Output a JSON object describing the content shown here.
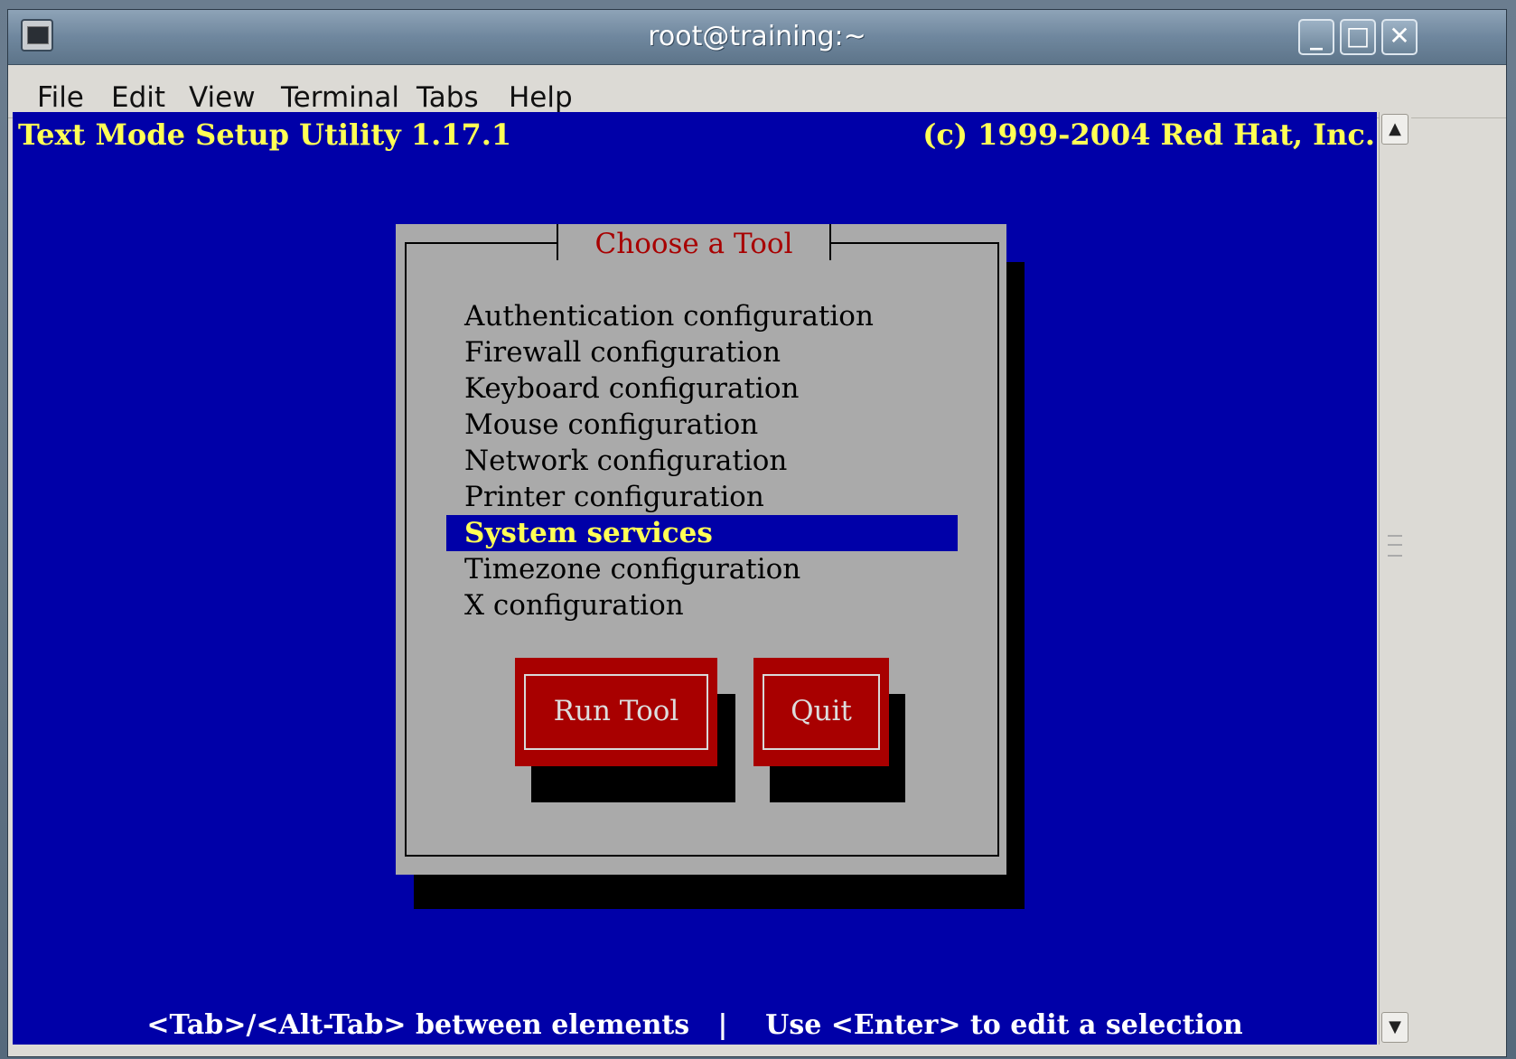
{
  "window": {
    "title": "root@training:~",
    "minimize_glyph": "_",
    "maximize_glyph": "□",
    "close_glyph": "✕"
  },
  "menubar": {
    "items": [
      "File",
      "Edit",
      "View",
      "Terminal",
      "Tabs",
      "Help"
    ]
  },
  "terminal": {
    "header_left": "Text Mode Setup Utility 1.17.1",
    "header_right": "(c) 1999-2004 Red Hat, Inc.",
    "footer": "<Tab>/<Alt-Tab> between elements   |    Use <Enter> to edit a selection",
    "colors": {
      "background": "#0000a8",
      "header_text": "#ffff55",
      "dialog_bg": "#aaaaaa",
      "button_bg": "#a80000",
      "dialog_title": "#a80000"
    }
  },
  "dialog": {
    "title": "Choose a Tool",
    "items": [
      "Authentication configuration",
      "Firewall configuration",
      "Keyboard configuration",
      "Mouse configuration",
      "Network configuration",
      "Printer configuration",
      "System services",
      "Timezone configuration",
      "X configuration"
    ],
    "selected": "System services",
    "buttons": {
      "run_tool": "Run Tool",
      "quit": "Quit"
    }
  },
  "scrollbar": {
    "up_icon": "arrow-up-icon",
    "down_icon": "arrow-down-icon"
  }
}
